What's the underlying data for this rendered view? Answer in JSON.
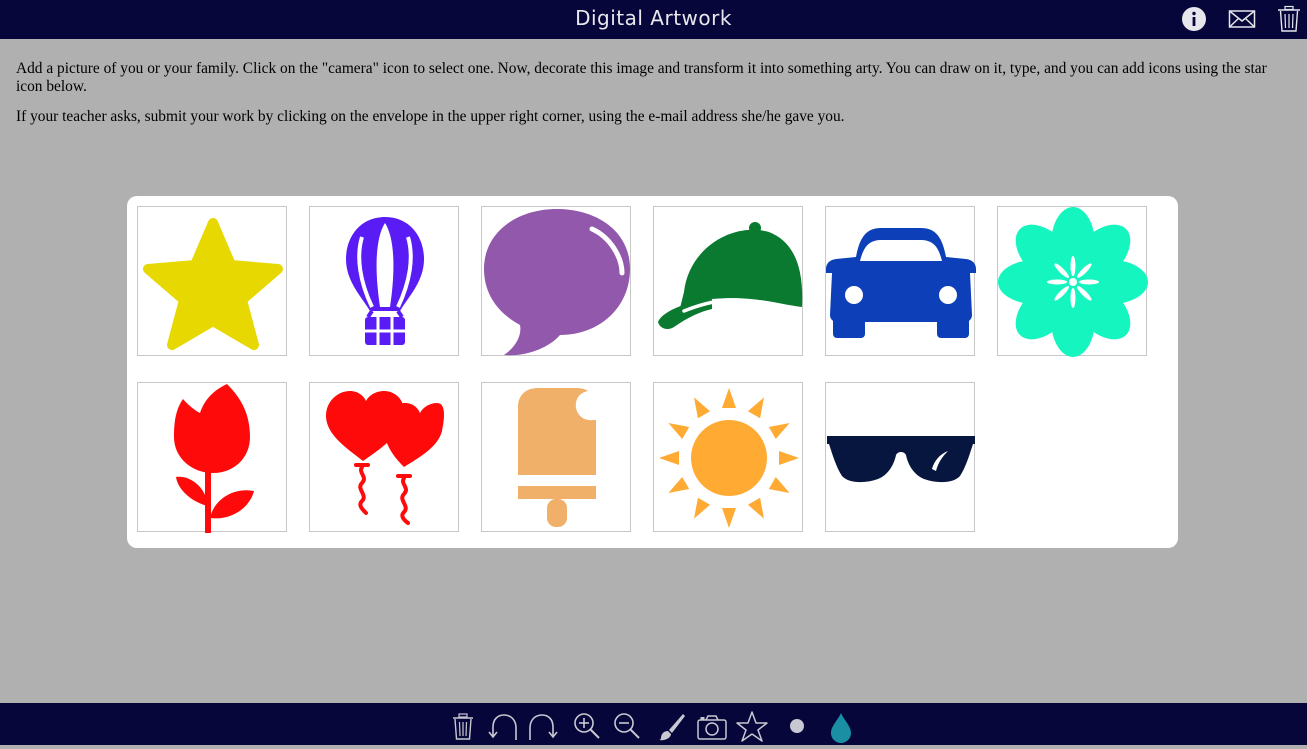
{
  "header": {
    "title": "Digital Artwork",
    "buttons": [
      {
        "name": "info-icon"
      },
      {
        "name": "envelope-icon"
      },
      {
        "name": "trash-icon"
      }
    ]
  },
  "instructions": {
    "paragraph1": "Add a picture of you or your family. Click on the \"camera\" icon to select one. Now, decorate this image and transform it into something arty. You can draw on it, type, and you can add icons using the star icon below.",
    "paragraph2": "If your teacher asks, submit your work by clicking on the envelope in the upper right corner, using the e-mail address she/he gave you."
  },
  "icon_picker": {
    "icons": [
      {
        "name": "star-icon",
        "color": "#e6d800"
      },
      {
        "name": "hot-air-balloon-icon",
        "color": "#5a1cf5"
      },
      {
        "name": "speech-bubble-icon",
        "color": "#9258ac"
      },
      {
        "name": "baseball-cap-icon",
        "color": "#0a7a30"
      },
      {
        "name": "car-icon",
        "color": "#0c3fb8"
      },
      {
        "name": "flower-icon",
        "color": "#14f5c0"
      },
      {
        "name": "tulip-icon",
        "color": "#ff0a0a"
      },
      {
        "name": "heart-balloons-icon",
        "color": "#ff0a0a"
      },
      {
        "name": "popsicle-icon",
        "color": "#f0b06a"
      },
      {
        "name": "sun-icon",
        "color": "#ffaa33"
      },
      {
        "name": "sunglasses-icon",
        "color": "#07163e"
      }
    ]
  },
  "toolbar": {
    "buttons": [
      {
        "name": "trash-icon"
      },
      {
        "name": "undo-icon"
      },
      {
        "name": "redo-icon"
      },
      {
        "name": "zoom-in-icon"
      },
      {
        "name": "zoom-out-icon"
      },
      {
        "name": "brush-icon"
      },
      {
        "name": "camera-icon"
      },
      {
        "name": "star-outline-icon"
      },
      {
        "name": "brush-size-dot-icon"
      },
      {
        "name": "color-drop-icon",
        "color": "#1a8fa3"
      }
    ]
  }
}
